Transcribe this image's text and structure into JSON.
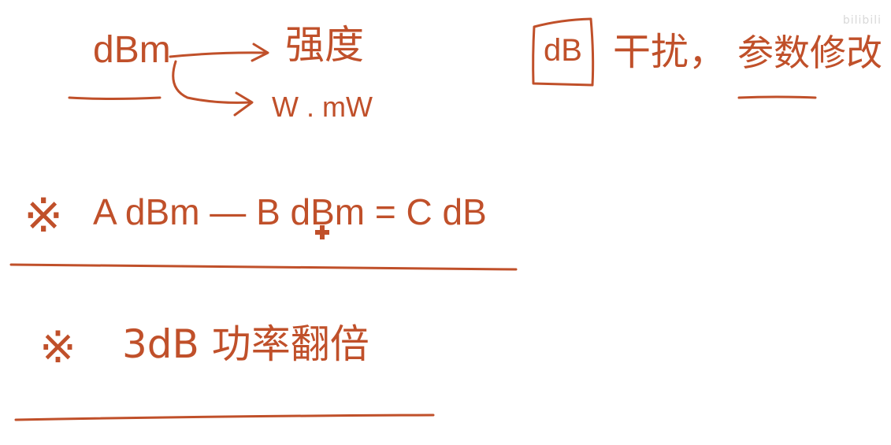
{
  "note": {
    "row1": {
      "unit": "dBm",
      "target_top": "强度",
      "target_bottom": "W . mW"
    },
    "boxed": {
      "label": "dB",
      "text": "干扰，",
      "underlined": "参数修改"
    },
    "row2": {
      "mark": "※",
      "formula": "A dBm — B dBm = C dB"
    },
    "row3": {
      "mark": "※",
      "text": "3dB 功率翻倍"
    }
  },
  "watermark": {
    "text": "bilibili"
  },
  "colors": {
    "ink": "#c0502a",
    "watermark": "#d9d9d9"
  }
}
